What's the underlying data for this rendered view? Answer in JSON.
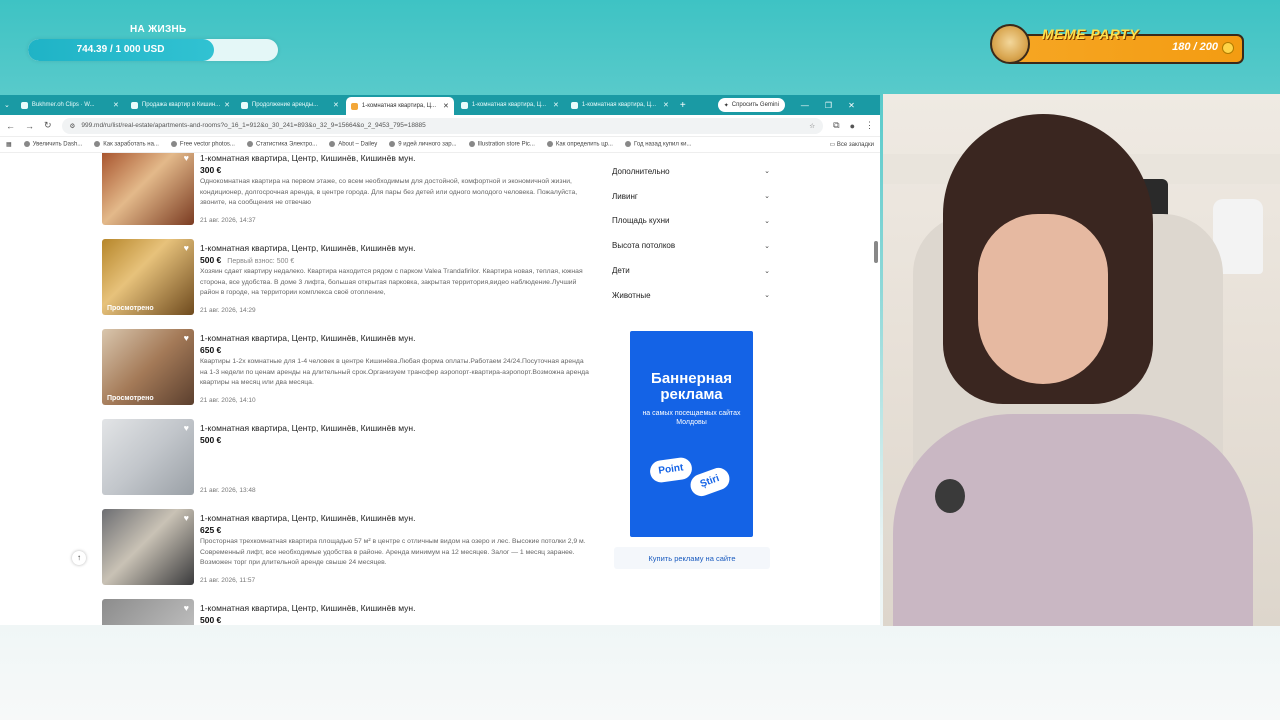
{
  "overlay": {
    "life_label": "НА ЖИЗНЬ",
    "life_text": "744.39 / 1 000 USD",
    "life_progress": 0.744,
    "meme_title": "MEME PARTY",
    "meme_count": "180 / 200"
  },
  "browser": {
    "tabs": [
      {
        "label": "Bukhmer.oh Clips · W..."
      },
      {
        "label": "Продажа квартир в Кишин..."
      },
      {
        "label": "Продолжение аренды..."
      },
      {
        "label": "1-комнатная квартира, Ц..."
      },
      {
        "label": "1-комнатная квартира, Ц..."
      },
      {
        "label": "1-комнатная квартира, Ц..."
      }
    ],
    "gemini_label": "Спросить Gemini",
    "url": "999.md/ru/list/real-estate/apartments-and-rooms?o_16_1=912&o_30_241=893&o_32_9=15664&o_2_9453_795=18885",
    "bookmarks": [
      "Увеличить Dash...",
      "Как заработать на...",
      "Free vector photos...",
      "Статистика Электро...",
      "About – Dailey",
      "9 идей личного зар...",
      "Illustration store Pic...",
      "Как определить цр...",
      "Год назад купил ки..."
    ],
    "bookmarks_all": "Все закладки"
  },
  "listings": [
    {
      "title": "1-комнатная квартира, Центр, Кишинёв, Кишинёв мун.",
      "price": "300 €",
      "old_price": "",
      "desc": "Однокомнатная квартира на первом этаже, со всем необходимым для достойной, комфортной и экономичной жизни, кондиционер, долгосрочная аренда, в центре города. Для пары без детей или одного молодого человека. Пожалуйста, звоните, на сообщения не отвечаю",
      "date": "21 авг. 2026, 14:37",
      "viewed": ""
    },
    {
      "title": "1-комнатная квартира, Центр, Кишинёв, Кишинёв мун.",
      "price": "500 €",
      "old_price": "Первый взнос: 500 €",
      "desc": "Хозяин сдает квартиру недалеко. Квартира находится рядом с парком Valea Trandafirilor. Квартира новая, теплая, южная сторона, все удобства. В доме 3 лифта, большая открытая парковка, закрытая территория,видео наблюдение.Лучший район в городе, на территории комплекса своё отопление,",
      "date": "21 авг. 2026, 14:29",
      "viewed": "Просмотрено"
    },
    {
      "title": "1-комнатная квартира, Центр, Кишинёв, Кишинёв мун.",
      "price": "650 €",
      "old_price": "",
      "desc": "Квартиры 1-2х комнатные для 1-4 человек в центре Кишинёва.Любая форма оплаты.Работаем 24/24.Посуточная аренда на 1-3 недели по ценам аренды на длительный срок.Организуем трансфер аэропорт-квартира-аэропорт.Возможна аренда квартиры на месяц или два месяца.",
      "date": "21 авг. 2026, 14:10",
      "viewed": "Просмотрено"
    },
    {
      "title": "1-комнатная квартира, Центр, Кишинёв, Кишинёв мун.",
      "price": "500 €",
      "old_price": "",
      "desc": "",
      "date": "21 авг. 2026, 13:48",
      "viewed": ""
    },
    {
      "title": "1-комнатная квартира, Центр, Кишинёв, Кишинёв мун.",
      "price": "625 €",
      "old_price": "",
      "desc": "Просторная трехкомнатная квартира площадью 57 м² в центре с отличным видом на озеро и лес. Высокие потолки 2,9 м. Современный лифт, все необходимые удобства в районе. Аренда минимум на 12 месяцев. Залог — 1 месяц заранее. Возможен торг при длительной аренде свыше 24 месяцев.",
      "date": "21 авг. 2026, 11:57",
      "viewed": ""
    },
    {
      "title": "1-комнатная квартира, Центр, Кишинёв, Кишинёв мун.",
      "price": "500 €",
      "old_price": "",
      "desc": "",
      "date": "",
      "viewed": ""
    }
  ],
  "filters": [
    "Дополнительно",
    "Ливинг",
    "Площадь кухни",
    "Высота потолков",
    "Дети",
    "Животные"
  ],
  "banner": {
    "title": "Баннерная реклама",
    "subtitle": "на самых посещаемых сайтах Молдовы",
    "logo1": "Point",
    "logo2": "Știri"
  },
  "buy_ad": "Купить рекламу на сайте",
  "colors": {
    "tabbar": "#1a9aa4",
    "banner": "#1463e6",
    "life_fill": "#1fb3c6"
  }
}
